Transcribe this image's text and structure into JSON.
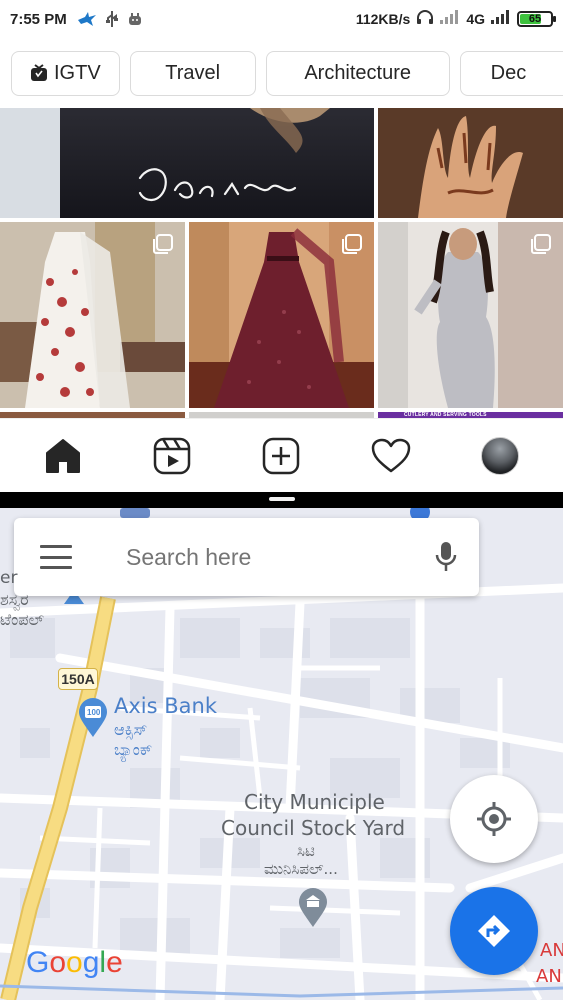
{
  "status_bar": {
    "time": "7:55 PM",
    "network_speed": "112KB/s",
    "network_type": "4G",
    "battery_percent": "65",
    "battery_level": 0.65,
    "icons": [
      "bird-icon",
      "usb-icon",
      "android-icon",
      "headphones-icon",
      "signal-icon",
      "signal-icon"
    ]
  },
  "chips": [
    {
      "label": "IGTV",
      "icon": "igtv-icon"
    },
    {
      "label": "Travel"
    },
    {
      "label": "Architecture"
    },
    {
      "label": "Dec"
    }
  ],
  "feed": {
    "tiles": [
      {
        "name": "tile-black-shirt",
        "colors": [
          "#1b1b20",
          "#2a2a30"
        ],
        "caption": "Mounir"
      },
      {
        "name": "tile-henna-hand",
        "colors": [
          "#7a4a2e",
          "#c79066"
        ]
      },
      {
        "name": "tile-floral-dress",
        "colors": [
          "#f2eee8",
          "#b9473c"
        ],
        "multi": true
      },
      {
        "name": "tile-maroon-gown",
        "colors": [
          "#5a1f2a",
          "#8c3c46"
        ],
        "multi": true
      },
      {
        "name": "tile-silver-dress",
        "colors": [
          "#d9d9de",
          "#3a2a26"
        ],
        "multi": true
      }
    ],
    "bottom_strip_text": "CUTLERY AND SERVING TOOLS"
  },
  "ig_nav": {
    "items": [
      "home-icon",
      "reels-icon",
      "new-post-icon",
      "activity-icon",
      "profile-avatar"
    ]
  },
  "maps": {
    "search_placeholder": "Search here",
    "route_badge": "150A",
    "labels": {
      "axis_bank": "Axis Bank",
      "axis_bank_kn_1": "ಆಕ್ಸಿಸ್",
      "axis_bank_kn_2": "ಬ್ಯಾಂಕ್",
      "council_line1": "City Municiple",
      "council_line2": "Council Stock Yard",
      "council_kn_1": "ಸಿಟಿ",
      "council_kn_2": "ಮುನಿಸಿಪಲ್...",
      "temple_partial_1": "er",
      "temple_partial_2": "ಶಸ್ವರ",
      "temple_partial_3": "ಟೆಂಪಲ್",
      "edge_label_1": "AN",
      "edge_label_2": "AN",
      "bank_pin_text": "100"
    },
    "logo": {
      "letters": [
        "G",
        "o",
        "o",
        "g",
        "l",
        "e"
      ],
      "colors": [
        "#4285F4",
        "#EA4335",
        "#FBBC05",
        "#4285F4",
        "#34A853",
        "#EA4335"
      ]
    },
    "colors": {
      "map_bg": "#e8eaf2",
      "road": "#ffffff",
      "highway": "#f6d77a",
      "accent": "#1a73e8",
      "poi": "#4a8bd6"
    }
  }
}
